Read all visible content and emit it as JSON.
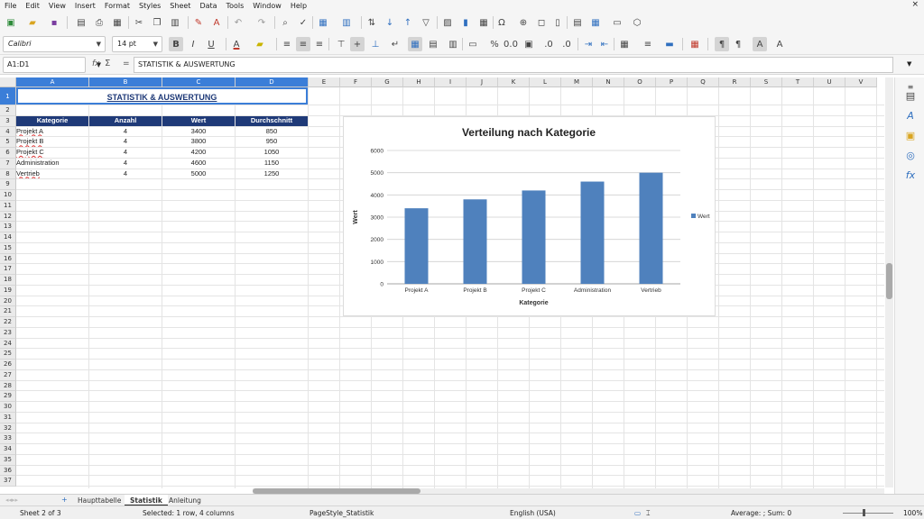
{
  "menu": [
    "File",
    "Edit",
    "View",
    "Insert",
    "Format",
    "Styles",
    "Sheet",
    "Data",
    "Tools",
    "Window",
    "Help"
  ],
  "menu_close": "×",
  "font_name": "Calibri",
  "font_size": "14 pt",
  "name_box": "A1:D1",
  "formula_fx": "fx",
  "formula_sum": "Σ",
  "formula_eq": "=",
  "formula_content": "STATISTIK & AUSWERTUNG",
  "columns": [
    "A",
    "B",
    "C",
    "D",
    "E",
    "F",
    "G",
    "H",
    "I",
    "J",
    "K",
    "L",
    "M",
    "N",
    "O",
    "P",
    "Q",
    "R",
    "S",
    "T",
    "U",
    "V"
  ],
  "rows": [
    "1",
    "2",
    "3",
    "4",
    "5",
    "6",
    "7",
    "8",
    "9",
    "10",
    "11",
    "12",
    "13",
    "14",
    "15",
    "16",
    "17",
    "18",
    "19",
    "20",
    "21",
    "22",
    "23",
    "24",
    "25",
    "26",
    "27",
    "28",
    "29",
    "30",
    "31",
    "32",
    "33",
    "34",
    "35",
    "36",
    "37"
  ],
  "sheet": {
    "title": "STATISTIK & AUSWERTUNG",
    "headers": [
      "Kategorie",
      "Anzahl",
      "Wert",
      "Durchschnitt"
    ],
    "data_rows": [
      [
        "Projekt A",
        "4",
        "3400",
        "850"
      ],
      [
        "Projekt B",
        "4",
        "3800",
        "950"
      ],
      [
        "Projekt C",
        "4",
        "4200",
        "1050"
      ],
      [
        "Administration",
        "4",
        "4600",
        "1150"
      ],
      [
        "Vertrieb",
        "4",
        "5000",
        "1250"
      ]
    ]
  },
  "chart_data": {
    "type": "bar",
    "title": "Verteilung nach Kategorie",
    "categories": [
      "Projekt A",
      "Projekt B",
      "Projekt C",
      "Administration",
      "Vertrieb"
    ],
    "series": [
      {
        "name": "Wert",
        "values": [
          3400,
          3800,
          4200,
          4600,
          5000
        ],
        "color": "#4f81bd"
      }
    ],
    "xlabel": "Kategorie",
    "ylabel": "Wert",
    "ylim": [
      0,
      6000
    ],
    "yticks": [
      "0",
      "1000",
      "2000",
      "3000",
      "4000",
      "5000",
      "6000"
    ],
    "grid": true,
    "legend": "right"
  },
  "tabs": [
    "Haupttabelle",
    "Statistik",
    "Anleitung"
  ],
  "tab_add": "+",
  "status": {
    "sheet": "Sheet 2 of 3",
    "selection": "Selected: 1 row, 4 columns",
    "page_style": "PageStyle_Statistik",
    "language": "English (USA)",
    "summary": "Average: ; Sum: 0",
    "zoom": "100%"
  },
  "colors": {
    "accent": "#3b7ed8",
    "header_fill": "#1f3a78",
    "title_text": "#1f3a78",
    "bar": "#4f81bd"
  }
}
